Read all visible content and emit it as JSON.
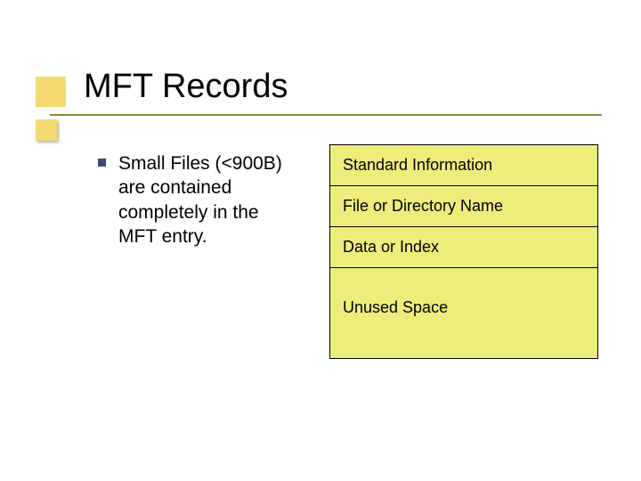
{
  "title": "MFT Records",
  "bullet": {
    "text": "Small Files (<900B) are contained completely in the MFT entry."
  },
  "diagram": {
    "rows": [
      "Standard Information",
      "File or Directory Name",
      "Data or Index",
      "Unused Space"
    ]
  }
}
